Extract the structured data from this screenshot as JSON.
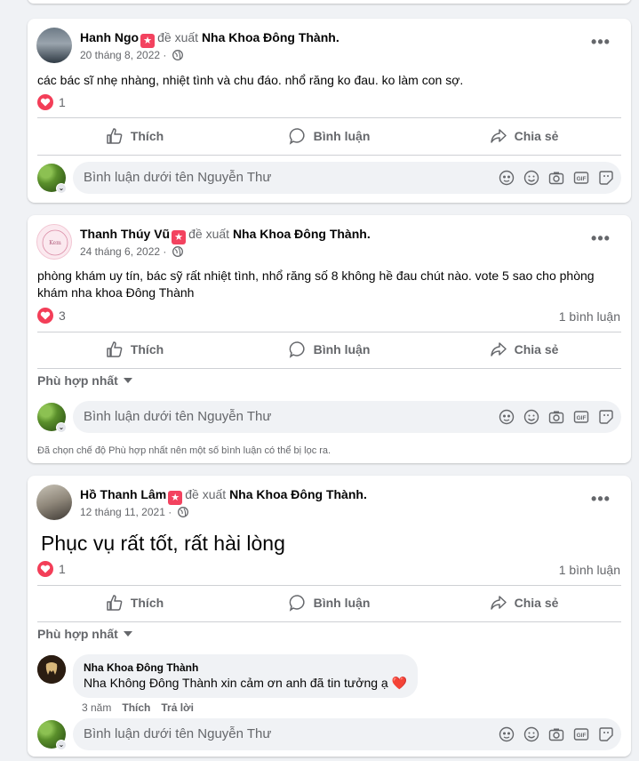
{
  "viewer_name_placeholder": "Bình luận dưới tên Nguyễn Thư",
  "actions": {
    "like": "Thích",
    "comment": "Bình luận",
    "share": "Chia sẻ"
  },
  "recommends": "đề xuất",
  "page_name": "Nha Khoa Đông Thành.",
  "filter_label": "Phù hợp nhất",
  "filter_note": "Đã chọn chế độ Phù hợp nhất nên một số bình luận có thể bị lọc ra.",
  "posts": [
    {
      "author": "Hanh Ngo",
      "date": "20 tháng 8, 2022 ·",
      "text": "các bác sĩ nhẹ nhàng, nhiệt tình và chu đáo.  nhổ răng ko đau. ko làm con sợ.",
      "reaction_count": "1"
    },
    {
      "author": "Thanh Thúy Vũ",
      "date": "24 tháng 6, 2022 ·",
      "text": "phòng khám uy tín, bác sỹ rất nhiệt tình, nhổ răng số 8 không hề đau chút nào. vote 5 sao cho phòng khám nha khoa Đông Thành",
      "reaction_count": "3",
      "comment_count": "1 bình luận"
    },
    {
      "author": "Hồ Thanh Lâm",
      "date": "12 tháng 11, 2021 ·",
      "text": "Phục vụ rất tốt, rất hài lòng",
      "reaction_count": "1",
      "comment_count": "1 bình luận",
      "reply": {
        "name": "Nha Khoa Đông Thành",
        "text": "Nha Không Đông Thành xin cảm ơn anh đã tin tưởng ạ ❤️",
        "age": "3 năm",
        "like": "Thích",
        "reply": "Trả lời"
      }
    }
  ],
  "icons": [
    "globe-icon",
    "more-icon",
    "heart-icon",
    "like-icon",
    "comment-icon",
    "share-icon",
    "caret-down-icon",
    "avatar-icon",
    "emoji-icon",
    "camera-icon",
    "gif-icon",
    "sticker-icon"
  ]
}
